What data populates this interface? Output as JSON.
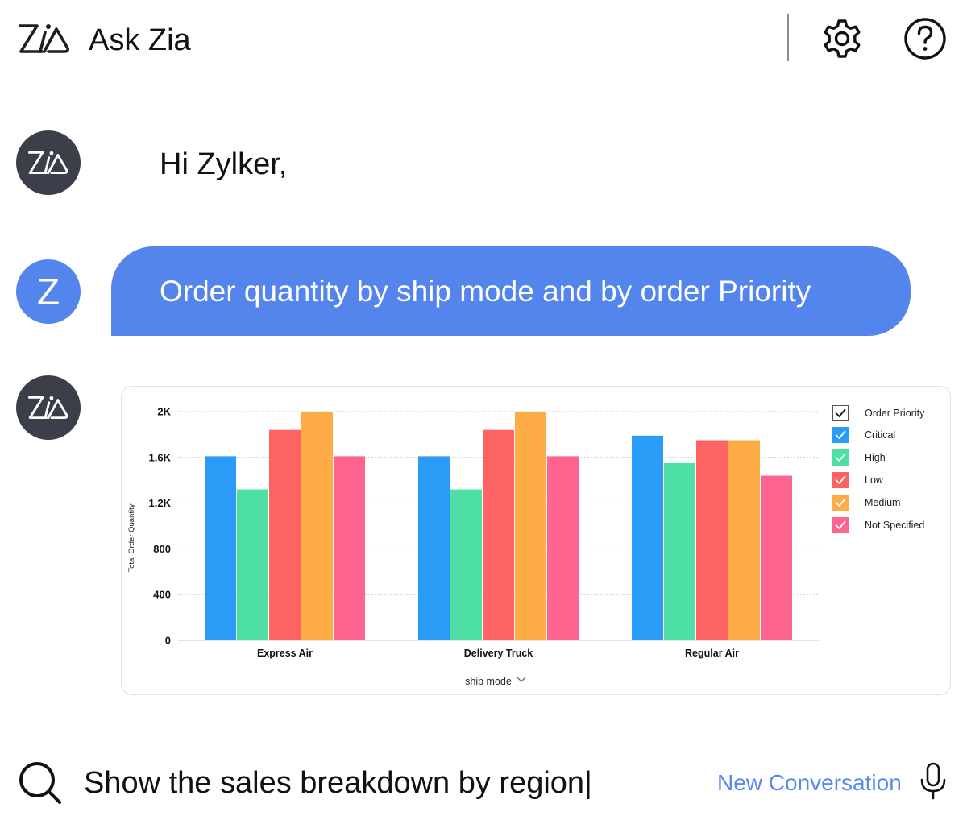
{
  "header": {
    "title": "Ask Zia",
    "icons": {
      "logo": "zia-logo-icon",
      "settings": "gear-icon",
      "help": "help-icon"
    }
  },
  "conversation": {
    "greeting": "Hi Zylker,",
    "user_avatar_letter": "Z",
    "user_message": "Order quantity by ship mode and by order Priority"
  },
  "chart_data": {
    "type": "bar",
    "title": "",
    "xlabel": "ship mode",
    "ylabel": "Total Order Quantity",
    "ylim": [
      0,
      2000
    ],
    "yticks": [
      "0",
      "400",
      "800",
      "1.2K",
      "1.6K",
      "2K"
    ],
    "ytick_values": [
      0,
      400,
      800,
      1200,
      1600,
      2000
    ],
    "grid": true,
    "legend_title": "Order Priority",
    "legend_position": "right",
    "categories": [
      "Express Air",
      "Delivery Truck",
      "Regular Air"
    ],
    "series": [
      {
        "name": "Critical",
        "color": "#2b9bf8",
        "values": [
          1610,
          1610,
          1790
        ]
      },
      {
        "name": "High",
        "color": "#4ddfa4",
        "values": [
          1320,
          1320,
          1550
        ]
      },
      {
        "name": "Low",
        "color": "#fd6363",
        "values": [
          1840,
          1840,
          1750
        ]
      },
      {
        "name": "Medium",
        "color": "#feac46",
        "values": [
          2000,
          2000,
          1750
        ]
      },
      {
        "name": "Not Specified",
        "color": "#fe6490",
        "values": [
          1610,
          1610,
          1440
        ]
      }
    ]
  },
  "input": {
    "value": "Show the sales breakdown by region|",
    "new_conversation_label": "New Conversation"
  },
  "colors": {
    "accent": "#5485ec",
    "zia_avatar_bg": "#3c3f49",
    "link": "#5b88ee"
  }
}
